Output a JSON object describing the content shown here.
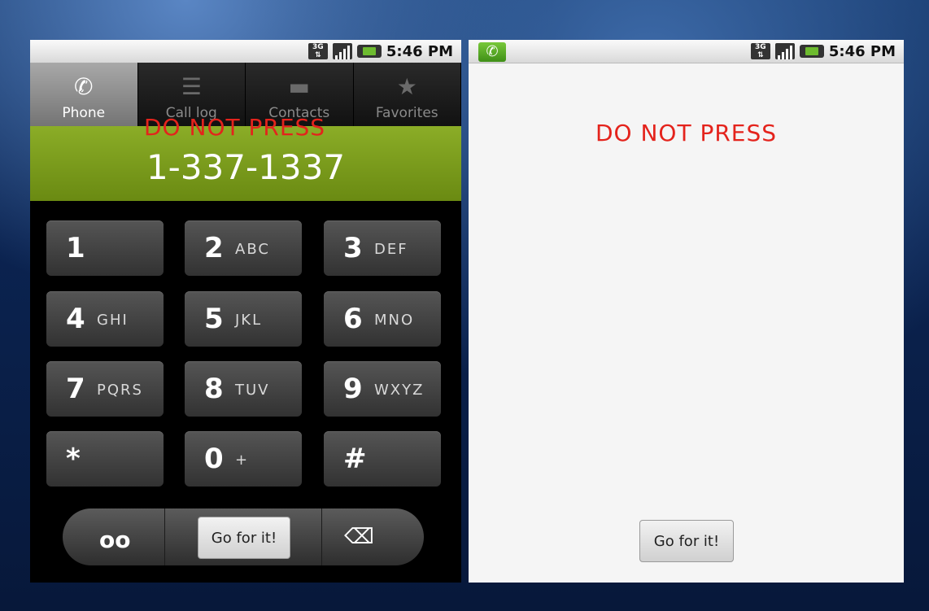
{
  "status": {
    "time": "5:46 PM",
    "network": "3G"
  },
  "tabs": [
    {
      "label": "Phone",
      "icon": "phone-icon"
    },
    {
      "label": "Call log",
      "icon": "call-log-icon"
    },
    {
      "label": "Contacts",
      "icon": "contacts-icon"
    },
    {
      "label": "Favorites",
      "icon": "star-icon"
    }
  ],
  "dialer": {
    "number": "1-337-1337",
    "warning": "DO NOT PRESS",
    "keys": [
      {
        "digit": "1",
        "letters": ""
      },
      {
        "digit": "2",
        "letters": "ABC"
      },
      {
        "digit": "3",
        "letters": "DEF"
      },
      {
        "digit": "4",
        "letters": "GHI"
      },
      {
        "digit": "5",
        "letters": "JKL"
      },
      {
        "digit": "6",
        "letters": "MNO"
      },
      {
        "digit": "7",
        "letters": "PQRS"
      },
      {
        "digit": "8",
        "letters": "TUV"
      },
      {
        "digit": "9",
        "letters": "WXYZ"
      },
      {
        "digit": "*",
        "letters": ""
      },
      {
        "digit": "0",
        "letters": "+"
      },
      {
        "digit": "#",
        "letters": ""
      }
    ],
    "go_label": "Go for it!"
  },
  "right_screen": {
    "warning": "DO NOT PRESS",
    "go_label": "Go for it!"
  },
  "colors": {
    "accent_green": "#7b9b1c",
    "warning_red": "#e4231c"
  }
}
